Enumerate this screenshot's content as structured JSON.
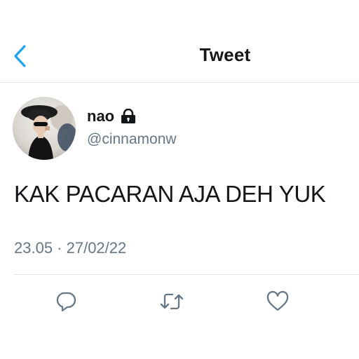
{
  "header": {
    "title": "Tweet",
    "back_icon": "chevron-left-icon"
  },
  "tweet": {
    "author": {
      "display_name": "nao",
      "handle": "@cinnamonw",
      "protected_icon": "lock-icon"
    },
    "text": "KAK PACARAN AJA DEH YUK",
    "timestamp": "23.05 · 27/02/22",
    "actions": [
      {
        "name": "reply",
        "icon": "reply-icon"
      },
      {
        "name": "retweet",
        "icon": "retweet-icon"
      },
      {
        "name": "like",
        "icon": "heart-icon"
      }
    ]
  },
  "colors": {
    "accent": "#1da1f2",
    "text_primary": "#14171a",
    "text_secondary": "#657786",
    "divider": "#e1e8ed"
  }
}
